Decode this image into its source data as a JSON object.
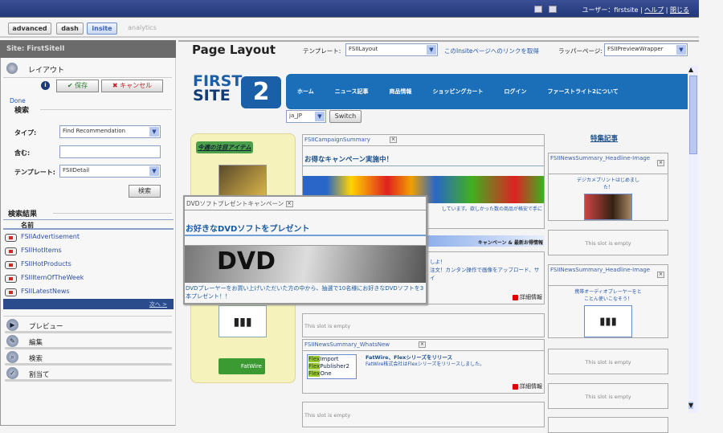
{
  "topbar": {
    "user_label": "ユーザー：firstsite",
    "help": "ヘルプ",
    "close": "閉じる",
    "sep": "|"
  },
  "tabs": [
    "advanced",
    "dash",
    "insite",
    "analytics"
  ],
  "left": {
    "site": "Site: FirstSiteII",
    "layout_label": "レイアウト",
    "save": "✔ 保存",
    "cancel": "✖ キャンセル",
    "done": "Done",
    "search_header": "検索",
    "type_label": "タイプ:",
    "type_value": "Find Recommendation",
    "contains_label": "含む:",
    "contains_value": "",
    "template_label": "テンプレート:",
    "template_value": "FSIIDetail",
    "search_button": "検索",
    "results_header": "検索結果",
    "name_col": "名前",
    "results": [
      "FSIIAdvertisement",
      "FSIIHotItems",
      "FSIIHotProducts",
      "FSIIItemOfTheWeek",
      "FSIILatestNews"
    ],
    "next": "次へ >",
    "nav": [
      {
        "label": "プレビュー",
        "icon": "preview-icon"
      },
      {
        "label": "編集",
        "icon": "edit-icon"
      },
      {
        "label": "検索",
        "icon": "search-icon"
      },
      {
        "label": "割当て",
        "icon": "assign-icon"
      }
    ]
  },
  "main": {
    "title": "Page Layout",
    "template_label": "テンプレート:",
    "template_value": "FSIILayout",
    "link": "このInsiteページへのリンクを取得",
    "wrapper_label": "ラッパーページ:",
    "wrapper_value": "FSIIPreviewWrapper"
  },
  "site": {
    "logo1": "FIRST",
    "logo2": "SITE",
    "logo_num": "2",
    "nav": [
      "ホーム",
      "ニュース記事",
      "商品情報",
      "ショッピングカート",
      "ログイン",
      "ファーストライト2について"
    ],
    "locale": "ja_JP",
    "switch": "Switch",
    "hot_item": "今週の注目アイテム",
    "fatwire": "FatWire",
    "campaign_slot": "FSIICampaignSummary",
    "campaign_title": "お得なキャンペーン実施中！",
    "campaign_text": "しています。欲しかった数の商品が格安で手に",
    "campaign_bar": "キャンペーン & 最新お得情報",
    "promo_text1": "しよ！",
    "promo_text2": "注文！カンタン操作で画像をアップロード、サイ",
    "detail": "詳細情報",
    "empty": "This slot is empty",
    "news_slot": "FSIINewsSummary_WhatsNew",
    "news_title": "FatWire、Flexシリーズをリリース",
    "news_text": "FatWire株式会社はFlexシリーズをリリースしました。",
    "flex": [
      "Import",
      "Publisher2",
      "One"
    ],
    "flex_prefix": "Flex",
    "feature": "特集記事",
    "headline_slot": "FSIINewsSummary_Headline-Image",
    "headline1": "デジカメプリントはじめました！",
    "headline2": "携帯オーディオプレーヤーをとことん使いこなそう！"
  },
  "popup": {
    "title": "DVDソフトプレゼントキャンペーン",
    "heading": "お好きなDVDソフトをプレゼント",
    "image_text": "DVD",
    "text": "DVDプレーヤーをお買い上げいただいた方の中から、抽選で10名様にお好きなDVDソフトを3本プレゼント！！"
  }
}
